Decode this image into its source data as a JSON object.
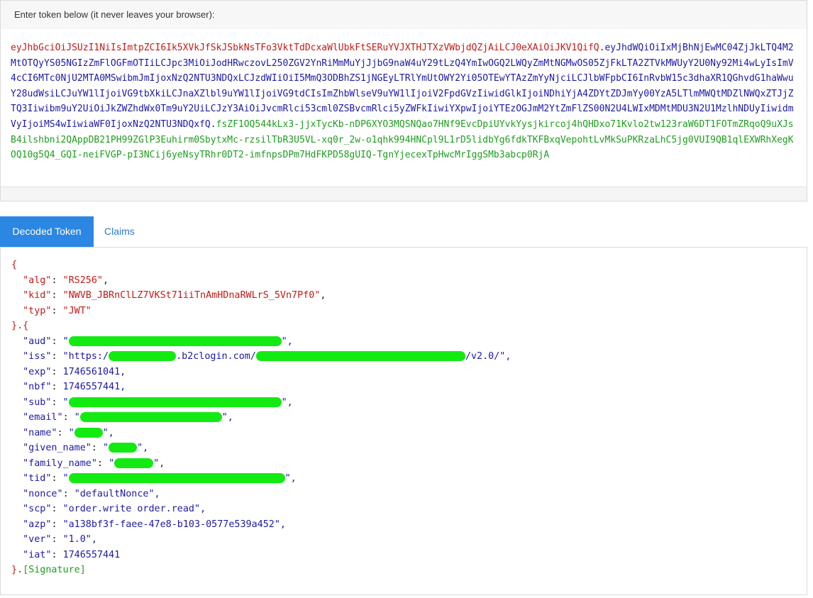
{
  "token_panel": {
    "header_label": "Enter token below (it never leaves your browser):",
    "token_header_part": "eyJhbGciOiJSUzI1NiIsImtpZCI6Ik5XVkJfSkJSbkNsTFo3VktTdDcxaWlUbkFtSERuYVJXTHJTXzVWbjdQZjAiLCJ0eXAiOiJKV1QifQ",
    "separator": ".",
    "token_payload_part": "eyJhdWQiOiIxMjBhNjEwMC04ZjJkLTQ4M2MtOTQyYS05NGIzZmFlOGFmOTIiLCJpc3MiOiJodHRwczovL250ZGV2YnRiMmMuYjJjbG9naW4uY29tLzQ4YmIwOGQ2LWQyZmMtNGMwOS05ZjFkLTA2ZTVkMWUyY2U0Ny92Mi4wLyIsImV4cCI6MTc0NjU2MTA0MSwibmJmIjoxNzQ2NTU3NDQxLCJzdWIiOiI5MmQ3ODBhZS1jNGEyLTRlYmUtOWY2Yi05OTEwYTAzZmYyNjciLCJlbWFpbCI6InRvbW15c3dhaXR1QGhvdG1haWwuY28udWsiLCJuYW1lIjoiVG9tbXkiLCJnaXZlbl9uYW1lIjoiVG9tdCIsImZhbWlseV9uYW1lIjoiV2FpdGVzIiwidGlkIjoiNDhiYjA4ZDYtZDJmYy00YzA5LTlmMWQtMDZlNWQxZTJjZTQ3Iiwibm9uY2UiOiJkZWZhdWx0Tm9uY2UiLCJzY3AiOiJvcmRlci53cml0ZSBvcmRlci5yZWFkIiwiYXpwIjoiYTEzOGJmM2YtZmFlZS00N2U4LWIxMDMtMDU3N2U1MzlhNDUyIiwidmVyIjoiMS4wIiwiaWF0IjoxNzQ2NTU3NDQxfQ",
    "token_signature_part": "fsZF1OQ544kLx3-jjxTycKb-nDP6XYO3MQSNQao7HNf9EvcDpiUYvkYysjkircoj4hQHDxo71Kvlo2tw123raW6DT1FOTmZRqoQ9uXJsB4ilshbni2QAppDB21PH99ZGlP3Euhirm0SbytxMc-rzsilTbR3U5VL-xq0r_2w-o1qhk994HNCpl9L1rD5lidbYg6fdkTKFBxqVepohtLvMkSuPKRzaLhC5jg0VUI9QB1qlEXWRhXegKOQ10g5Q4_GQI-neiFVGP-pI3NCij6yeNsyTRhr0DT2-imfnpsDPm7HdFKPD58gUIQ-TgnYjecexTpHwcMrIggSMb3abcp0RjA"
  },
  "tabs": [
    {
      "label": "Decoded Token",
      "active": true
    },
    {
      "label": "Claims",
      "active": false
    }
  ],
  "decoded": {
    "open_brace": "{",
    "header_close": "}.{",
    "payload_close": "}.",
    "signature_label": "[Signature]",
    "header": [
      {
        "key": "\"alg\"",
        "value": "\"RS256\"",
        "comma": ","
      },
      {
        "key": "\"kid\"",
        "value": "\"NWVB_JBRnClLZ7VKSt71iiTnAmHDnaRWLrS_5Vn7Pf0\"",
        "comma": ","
      },
      {
        "key": "\"typ\"",
        "value": "\"JWT\"",
        "comma": ""
      }
    ],
    "payload": [
      {
        "key": "\"aud\"",
        "value": "\"",
        "suffix": "\","
      },
      {
        "key": "\"iss\"",
        "value": "\"https:/",
        "middle": ".b2clogin.com/",
        "suffix": "/v2.0/\","
      },
      {
        "key": "\"exp\"",
        "value": "1746561041,"
      },
      {
        "key": "\"nbf\"",
        "value": "1746557441,"
      },
      {
        "key": "\"sub\"",
        "value": "\"",
        "suffix": "\","
      },
      {
        "key": "\"email\"",
        "value": "\"",
        "suffix": "\","
      },
      {
        "key": "\"name\"",
        "value": "\"",
        "suffix": "\","
      },
      {
        "key": "\"given_name\"",
        "value": "\"",
        "suffix": "\","
      },
      {
        "key": "\"family_name\"",
        "value": "\"",
        "suffix": "\","
      },
      {
        "key": "\"tid\"",
        "value": "\"",
        "suffix": "\","
      },
      {
        "key": "\"nonce\"",
        "value": "\"defaultNonce\","
      },
      {
        "key": "\"scp\"",
        "value": "\"order.write order.read\","
      },
      {
        "key": "\"azp\"",
        "value": "\"a138bf3f-faee-47e8-b103-0577e539a452\","
      },
      {
        "key": "\"ver\"",
        "value": "\"1.0\","
      },
      {
        "key": "\"iat\"",
        "value": "1746557441"
      }
    ]
  },
  "colors": {
    "accent": "#2b87e3",
    "header_red": "#c41a16",
    "payload_blue": "#1c1aa6",
    "signature_green": "#1f9d1f",
    "redaction_green": "#12ea12"
  }
}
